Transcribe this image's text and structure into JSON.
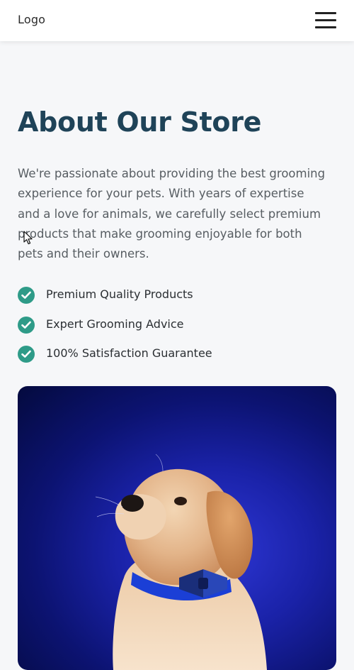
{
  "header": {
    "logo_text": "Logo"
  },
  "about": {
    "title": "About Our Store",
    "description": "We're passionate about providing the best grooming experience for your pets. With years of expertise and a love for animals, we carefully select premium products that make grooming enjoyable for both pets and their owners.",
    "features": [
      {
        "label": "Premium Quality Products",
        "icon": "check-circle-icon"
      },
      {
        "label": "Expert Grooming Advice",
        "icon": "check-circle-icon"
      },
      {
        "label": "100% Satisfaction Guarantee",
        "icon": "check-circle-icon"
      }
    ]
  },
  "colors": {
    "title": "#1f4358",
    "accent": "#2e9b88",
    "background": "#f6f7f9",
    "header_bg": "#ffffff",
    "hero_bg": "#1a22a8"
  },
  "icons": {
    "menu": "hamburger-menu-icon",
    "check": "check-circle-icon",
    "cursor": "mouse-cursor-icon"
  }
}
